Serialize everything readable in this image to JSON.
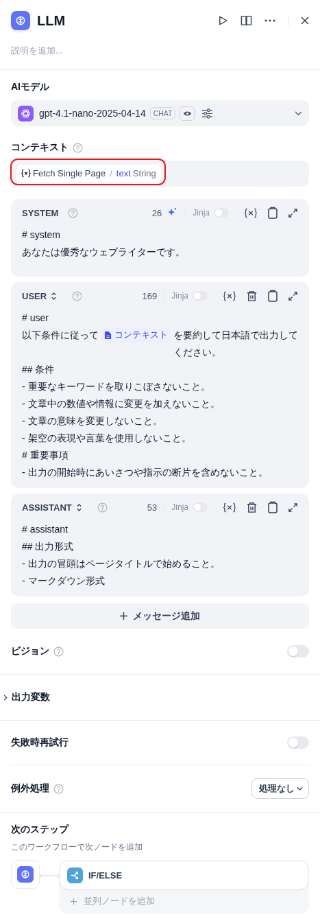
{
  "header": {
    "title": "LLM",
    "placeholder": "説明を追加..."
  },
  "model": {
    "label": "AIモデル",
    "name": "gpt-4.1-nano-2025-04-14",
    "badge": "CHAT"
  },
  "context": {
    "label": "コンテキスト",
    "source": "Fetch Single Page",
    "separator": "/",
    "variable": "text",
    "type": "String",
    "highlighted": true
  },
  "messages": [
    {
      "kind": "system",
      "role": "SYSTEM",
      "count": "26",
      "jinja_label": "Jinja",
      "jinja": false,
      "lines": [
        "# system",
        "あなたは優秀なウェブライターです。"
      ]
    },
    {
      "kind": "user",
      "role": "USER",
      "count": "169",
      "jinja_label": "Jinja",
      "jinja": false,
      "lines": [
        "# user",
        {
          "before": "以下条件に従って",
          "variable": "コンテキスト",
          "after": "を要約して日本語で出力してください。"
        },
        "## 条件",
        "- 重要なキーワードを取りこぼさないこと。",
        "- 文章中の数値や情報に変更を加えないこと。",
        "- 文章の意味を変更しないこと。",
        "- 架空の表現や言葉を使用しないこと。",
        "# 重要事項",
        "- 出力の開始時にあいさつや指示の断片を含めないこと。"
      ]
    },
    {
      "kind": "assistant",
      "role": "ASSISTANT",
      "count": "53",
      "jinja_label": "Jinja",
      "jinja": false,
      "lines": [
        "# assistant",
        "## 出力形式",
        "- 出力の冒頭はページタイトルで始めること。",
        "- マークダウン形式"
      ]
    }
  ],
  "add_message": "メッセージ追加",
  "vision": {
    "label": "ビジョン",
    "on": false
  },
  "output_vars": {
    "label": "出力変数",
    "expanded": false
  },
  "retry": {
    "label": "失敗時再試行",
    "on": false
  },
  "error_handling": {
    "label": "例外処理",
    "value": "処理なし"
  },
  "next_step": {
    "title": "次のステップ",
    "subtitle": "このワークフローで次ノードを追加",
    "nodes": [
      {
        "label": "IF/ELSE"
      }
    ],
    "add_parallel": "並列ノードを追加"
  }
}
